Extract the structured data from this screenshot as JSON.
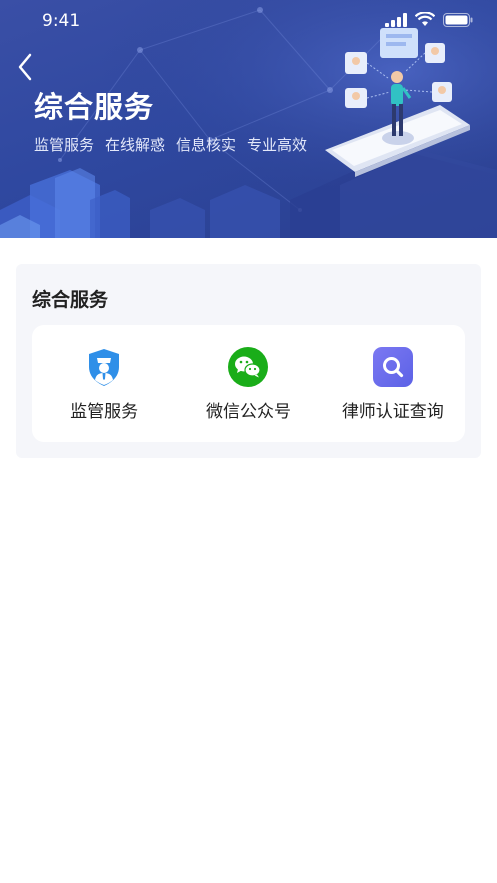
{
  "status": {
    "time": "9:41"
  },
  "banner": {
    "title": "综合服务",
    "tags": [
      "监管服务",
      "在线解惑",
      "信息核实",
      "专业高效"
    ]
  },
  "section": {
    "title": "综合服务",
    "items": [
      {
        "label": "监管服务",
        "icon": "shield-officer-icon",
        "color": "#2f8fe8"
      },
      {
        "label": "微信公众号",
        "icon": "wechat-icon",
        "color": "#1aad19"
      },
      {
        "label": "律师认证查询",
        "icon": "search-icon",
        "color": "#6c6cf0"
      }
    ]
  },
  "colors": {
    "banner": "#2f48a0",
    "card_bg": "#f5f6fa"
  }
}
